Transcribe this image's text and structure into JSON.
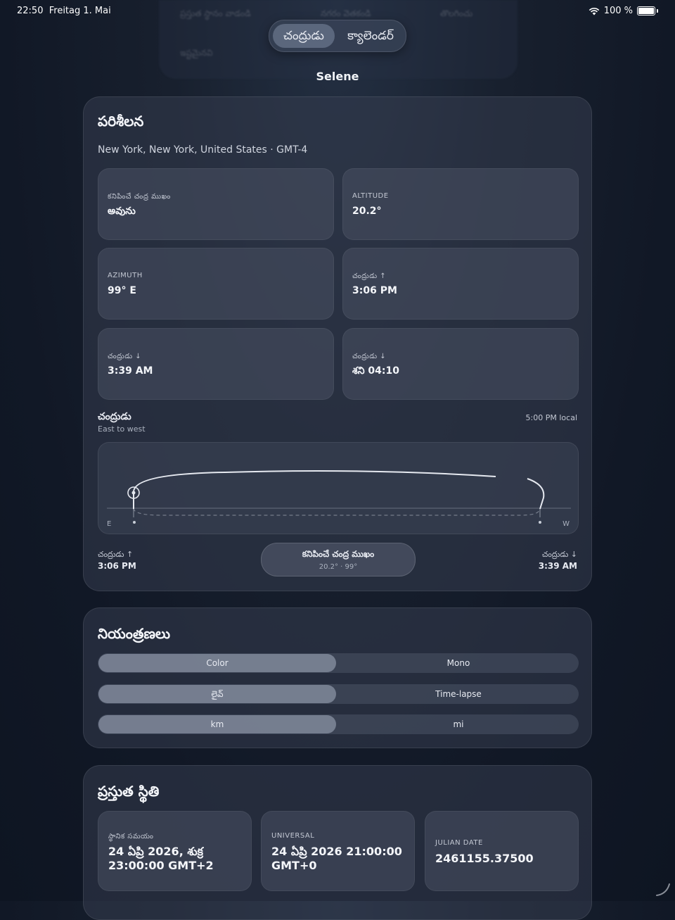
{
  "status": {
    "time": "22:50",
    "date": "Freitag 1. Mai",
    "battery": "100 %"
  },
  "ghost": {
    "items": [
      "ప్రస్తుత స్థానం వాడండి",
      "నగరం వెతకండి",
      "తొలగించు",
      "ఇష్టమైనవి"
    ]
  },
  "top_segment": {
    "options": [
      "చంద్రుడు",
      "క్యాలెండర్"
    ],
    "selected": "చంద్రుడు"
  },
  "app_title": "Selene",
  "observation": {
    "title": "పరిశీలన",
    "location": "New York, New York, United States · GMT-4",
    "tiles": [
      {
        "label": "కనిపించే చంద్ర ముఖం",
        "value": "అవును"
      },
      {
        "label": "ALTITUDE",
        "value": "20.2°"
      },
      {
        "label": "AZIMUTH",
        "value": "99° E"
      },
      {
        "label": "చంద్రుడు ↑",
        "value": "3:06 PM"
      },
      {
        "label": "చంద్రుడు ↓",
        "value": "3:39 AM"
      },
      {
        "label": "చంద్రుడు ↓",
        "value": "శని 04:10"
      }
    ],
    "path": {
      "title": "చంద్రుడు",
      "subtitle": "East to west",
      "time": "5:00 PM local",
      "east": "E",
      "west": "W",
      "rise_label": "చంద్రుడు ↑",
      "rise_time": "3:06 PM",
      "set_label": "చంద్రుడు ↓",
      "set_time": "3:39 AM",
      "pill_title": "కనిపించే చంద్ర ముఖం",
      "pill_sub": "20.2° · 99°"
    }
  },
  "controls": {
    "title": "నియంత్రణలు",
    "rows": [
      {
        "a": "Color",
        "b": "Mono",
        "selected": "Color"
      },
      {
        "a": "లైవ్",
        "b": "Time-lapse",
        "selected": "లైవ్"
      },
      {
        "a": "km",
        "b": "mi",
        "selected": "km"
      }
    ]
  },
  "current": {
    "title": "ప్రస్తుత స్థితి",
    "tiles": [
      {
        "label": "స్థానిక సమయం",
        "line1": "24 ఏప్రి 2026, శుక్ర",
        "line2": "23:00:00 GMT+2"
      },
      {
        "label": "UNIVERSAL",
        "line1": "24 ఏప్రి 2026 21:00:00",
        "line2": "GMT+0"
      },
      {
        "label": "JULIAN DATE",
        "line1": "2461155.37500",
        "line2": ""
      }
    ]
  }
}
